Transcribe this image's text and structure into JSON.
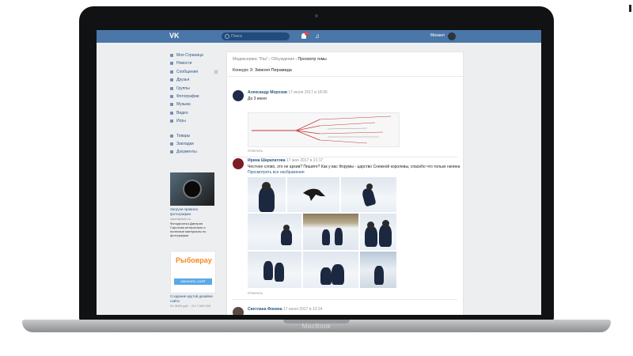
{
  "device": {
    "label": "MacBook"
  },
  "header": {
    "logo": "VK",
    "search_placeholder": "Поиск",
    "user_name": "Михаил"
  },
  "sidebar": {
    "items": [
      {
        "label": "Моя Страница",
        "icon": "home-icon"
      },
      {
        "label": "Новости",
        "icon": "news-icon"
      },
      {
        "label": "Сообщения",
        "icon": "message-icon",
        "badge": "4"
      },
      {
        "label": "Друзья",
        "icon": "friends-icon"
      },
      {
        "label": "Группы",
        "icon": "groups-icon"
      },
      {
        "label": "Фотографии",
        "icon": "photo-icon"
      },
      {
        "label": "Музыка",
        "icon": "music-icon"
      },
      {
        "label": "Видео",
        "icon": "video-icon"
      },
      {
        "label": "Игры",
        "icon": "games-icon"
      }
    ],
    "items2": [
      {
        "label": "Товары",
        "icon": "goods-icon"
      },
      {
        "label": "Закладки",
        "icon": "bookmark-icon"
      },
      {
        "label": "Документы",
        "icon": "document-icon"
      }
    ]
  },
  "ads": [
    {
      "title": "Загрузи правила фотографии",
      "sub": "xiaomiphoto.ru",
      "text": "Фотодесятка Дмитрия Сиротова интересные и полезные материалы по фотографии"
    },
    {
      "brand": "Рыбоврау",
      "button": "ЗАКАЗАТЬ САЙТ",
      "title": "Создание крутой дизайна сайта",
      "sub": "От 3000 руб. · От 7 000 000"
    }
  ],
  "panel": {
    "breadcrumb": [
      "Медиасервис \"Раз\"",
      "Обсуждения",
      "Просмотр темы"
    ],
    "topic_title": "Конкурс 3: Зимняя Пирамида",
    "comments": [
      {
        "author": "Александр Морозов",
        "date": "17 июня 2017 в 18:06",
        "text": "До 3 июня",
        "reply": "Ответить"
      },
      {
        "author": "Ирина Шарапатова",
        "date": "17 мая 2017 в 21:17",
        "text": "Честное слово, это не архив? Пишите? Как у вас Форумы - царство Снежной королевы, спасибо что только начинается...",
        "link": "Просмотреть все изображения",
        "reply": "Ответить"
      },
      {
        "author": "Светлана Фокина",
        "date": "17 июня 2017 в 13:24"
      }
    ]
  },
  "colors": {
    "vk_blue": "#4a76a8",
    "link": "#2a5885",
    "page_bg": "#edeef0"
  }
}
